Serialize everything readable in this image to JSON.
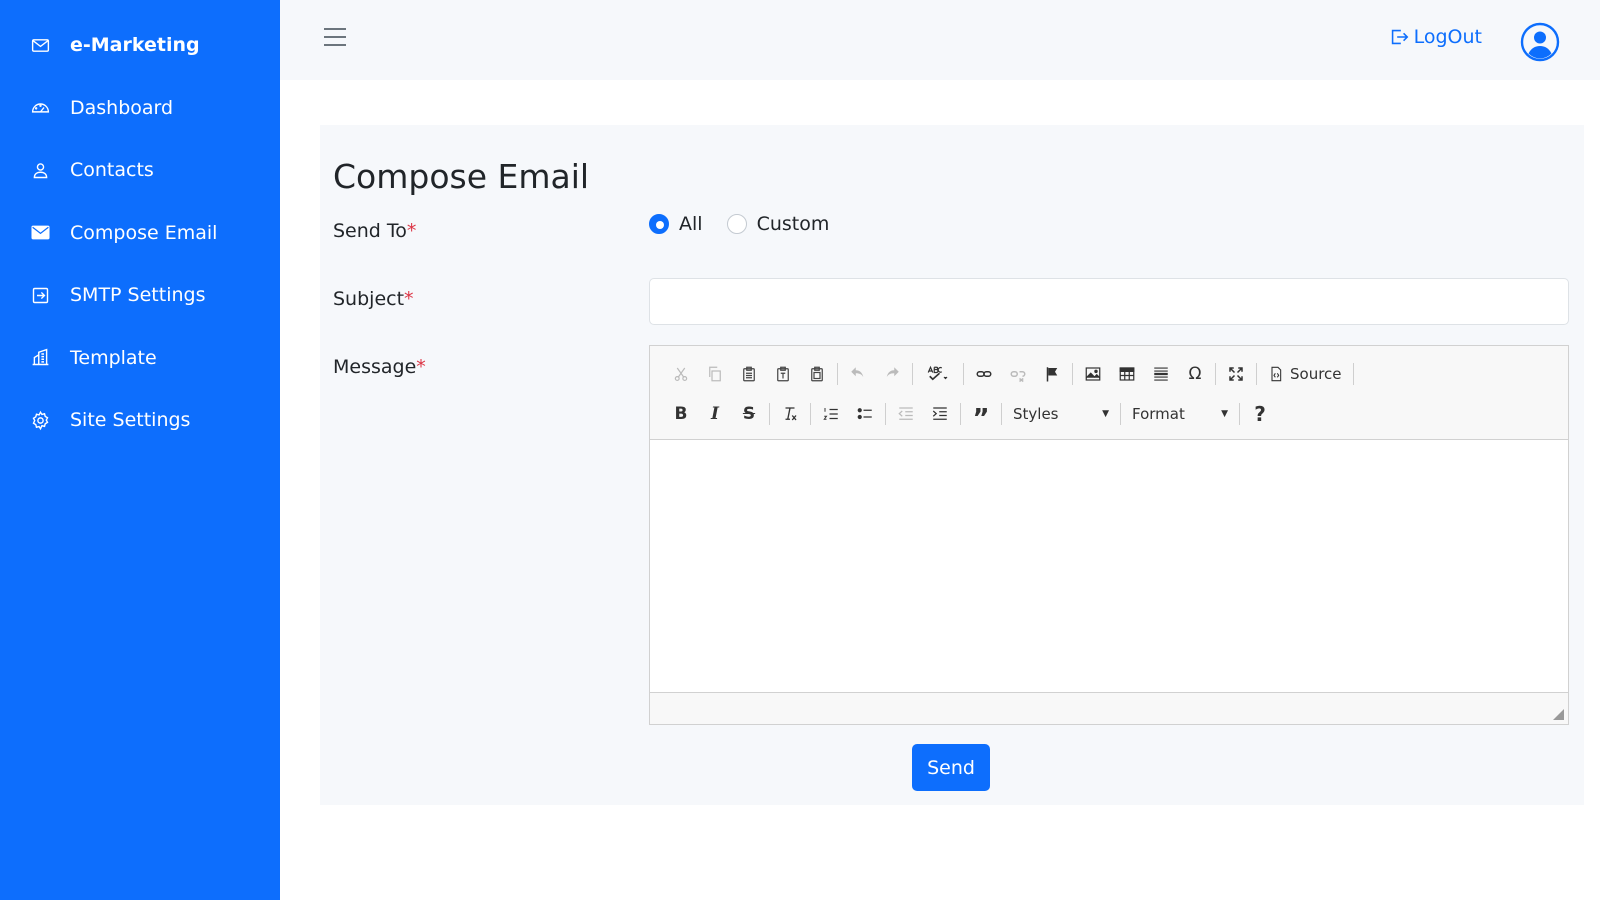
{
  "sidebar": {
    "items": [
      {
        "label": "e-Marketing",
        "icon": "envelope-outline-icon"
      },
      {
        "label": "Dashboard",
        "icon": "speedometer-icon"
      },
      {
        "label": "Contacts",
        "icon": "person-icon"
      },
      {
        "label": "Compose Email",
        "icon": "envelope-fill-icon"
      },
      {
        "label": "SMTP Settings",
        "icon": "box-arrow-in-right-icon"
      },
      {
        "label": "Template",
        "icon": "building-icon"
      },
      {
        "label": "Site Settings",
        "icon": "gear-icon"
      }
    ],
    "bg_color": "#0d6efd"
  },
  "topbar": {
    "logout_label": "LogOut",
    "accent_color": "#0d6efd"
  },
  "main": {
    "title": "Compose Email",
    "send_to": {
      "label": "Send To",
      "required_mark": "*",
      "options": [
        {
          "label": "All",
          "checked": true
        },
        {
          "label": "Custom",
          "checked": false
        }
      ]
    },
    "subject": {
      "label": "Subject",
      "required_mark": "*",
      "value": ""
    },
    "message": {
      "label": "Message",
      "required_mark": "*"
    },
    "editor": {
      "source_label": "Source",
      "styles_label": "Styles",
      "format_label": "Format",
      "help_label": "?"
    },
    "send_label": "Send"
  }
}
